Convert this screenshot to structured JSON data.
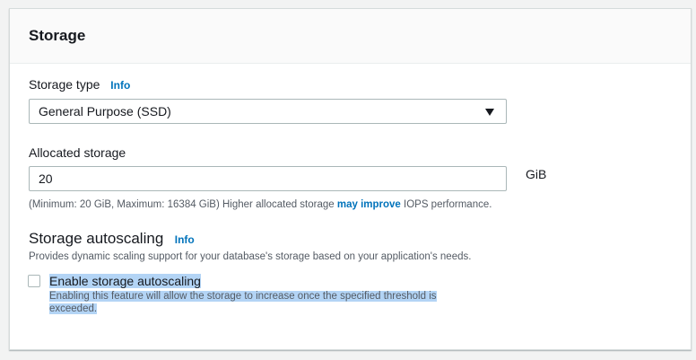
{
  "panel": {
    "title": "Storage"
  },
  "storage_type": {
    "label": "Storage type",
    "info": "Info",
    "selected": "General Purpose (SSD)"
  },
  "allocated_storage": {
    "label": "Allocated storage",
    "value": "20",
    "unit": "GiB",
    "hint_pre": "(Minimum: 20 GiB, Maximum: 16384 GiB) Higher allocated storage ",
    "hint_link": "may improve",
    "hint_post": " IOPS performance."
  },
  "autoscaling": {
    "title": "Storage autoscaling",
    "info": "Info",
    "description": "Provides dynamic scaling support for your database's storage based on your application's needs.",
    "checkbox_label": "Enable storage autoscaling",
    "checkbox_checked": false,
    "checkbox_desc_line1": "Enabling this feature will allow the storage to increase once the specified threshold is",
    "checkbox_desc_line2": "exceeded."
  }
}
